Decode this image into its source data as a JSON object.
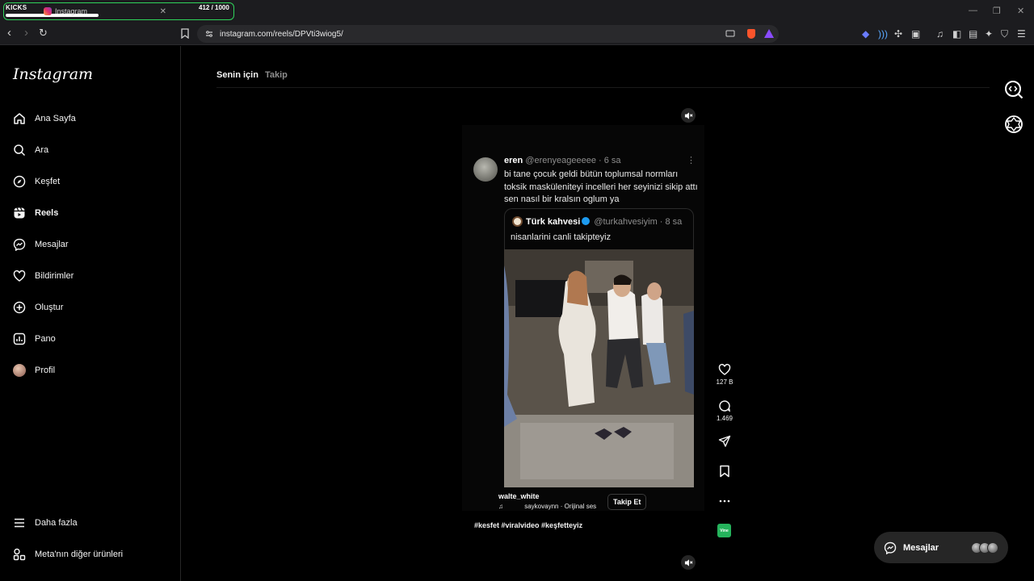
{
  "overlay": {
    "brand": "KICKS",
    "counter": "412  / 1000",
    "progress_percent": 41
  },
  "browser": {
    "tab_title": "Instagram",
    "url": "instagram.com/reels/DPVti3wiog5/"
  },
  "sidebar": {
    "logo": "Instagram",
    "items": [
      {
        "label": "Ana Sayfa",
        "icon": "home-icon"
      },
      {
        "label": "Ara",
        "icon": "search-icon"
      },
      {
        "label": "Keşfet",
        "icon": "compass-icon"
      },
      {
        "label": "Reels",
        "icon": "reels-icon"
      },
      {
        "label": "Mesajlar",
        "icon": "messenger-icon"
      },
      {
        "label": "Bildirimler",
        "icon": "heart-icon"
      },
      {
        "label": "Oluştur",
        "icon": "plus-square-icon"
      },
      {
        "label": "Pano",
        "icon": "dashboard-icon"
      },
      {
        "label": "Profil",
        "icon": "avatar"
      }
    ],
    "more": "Daha fazla",
    "meta": "Meta'nın diğer ürünleri"
  },
  "feed_tabs": {
    "active": "Senin için",
    "inactive": "Takip"
  },
  "tweet": {
    "name": "eren",
    "handle": "@erenyeageeeee · 6 sa",
    "text": "bi tane çocuk geldi bütün toplumsal normları toksik maskülenitеyi incelleri her seyinizi sikip attı sen nasıl bir kralsın oglum ya",
    "quote": {
      "name": "Türk kahvesi",
      "handle": "@turkahvesiyim · 8 sa",
      "text": "nisanlarini canli takipteyiz"
    }
  },
  "reel": {
    "username": "walte_white",
    "audio": "saykovaynn · Orijinal ses",
    "follow": "Takip Et",
    "hashtags": "#kesfet #viralvideo #keşfetteyiz",
    "likes": "127 B",
    "comments": "1.469",
    "audio_thumb": "Vine"
  },
  "messages": {
    "label": "Mesajlar"
  }
}
